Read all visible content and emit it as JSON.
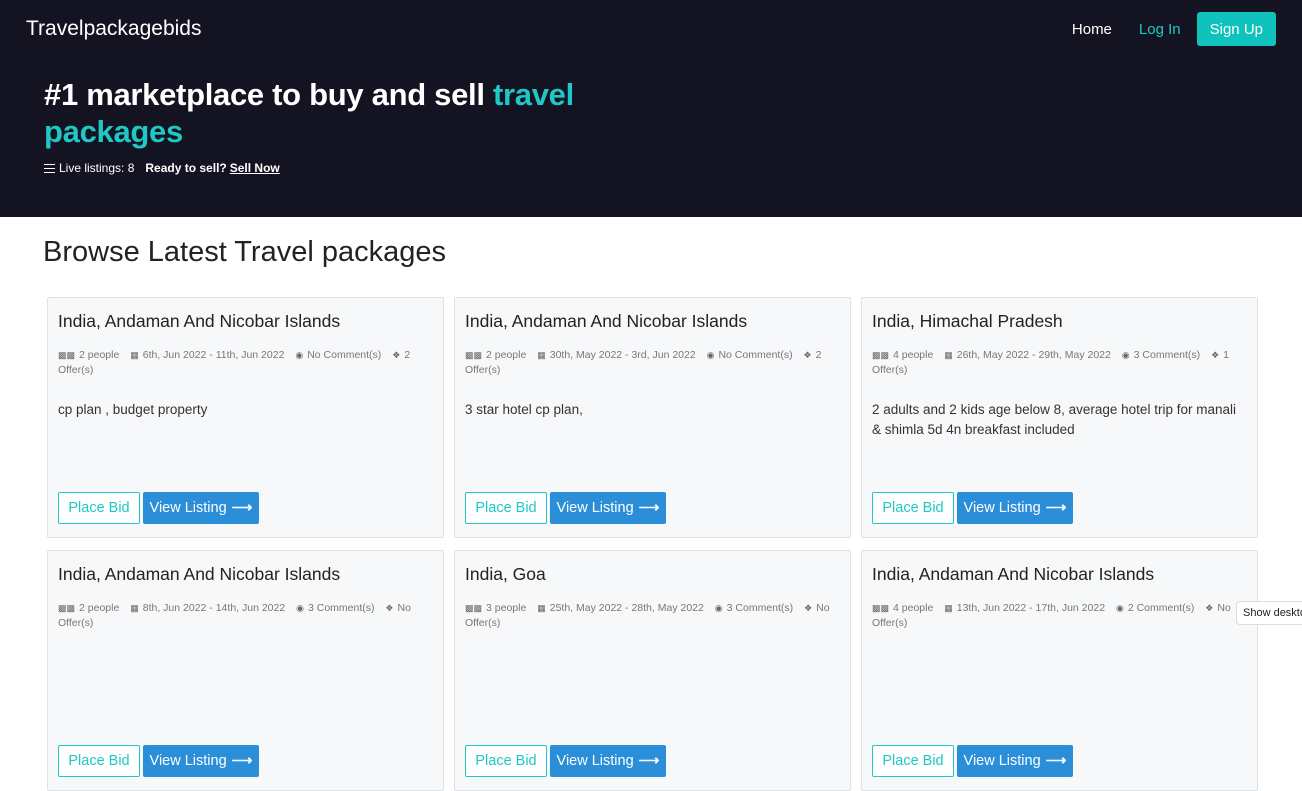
{
  "header": {
    "brand": "Travelpackagebids",
    "nav": {
      "home": "Home",
      "login": "Log In",
      "signup": "Sign Up"
    },
    "headline_main": "#1 marketplace to buy and sell ",
    "headline_accent": "travel packages",
    "live_listings": "Live listings: 8",
    "ready_text": "Ready to sell?",
    "sell_now": "Sell Now"
  },
  "section_title": "Browse Latest Travel packages",
  "listings": [
    {
      "title": "India, Andaman And Nicobar Islands",
      "people": "2 people",
      "dates": "6th, Jun 2022 - 11th, Jun 2022",
      "comments": "No Comment(s)",
      "offers_num": "2",
      "offers_label": "Offer(s)",
      "desc": "cp plan , budget property"
    },
    {
      "title": "India, Andaman And Nicobar Islands",
      "people": "2 people",
      "dates": "30th, May 2022 - 3rd, Jun 2022",
      "comments": "No Comment(s)",
      "offers_num": "2",
      "offers_label": "Offer(s)",
      "desc": "3 star hotel cp plan,"
    },
    {
      "title": "India, Himachal Pradesh",
      "people": "4 people",
      "dates": "26th, May 2022 - 29th, May 2022",
      "comments": "3 Comment(s)",
      "offers_num": "1",
      "offers_label": "Offer(s)",
      "desc": "2 adults and 2 kids age below 8, average hotel trip for manali & shimla 5d 4n breakfast included"
    },
    {
      "title": "India, Andaman And Nicobar Islands",
      "people": "2 people",
      "dates": "8th, Jun 2022 - 14th, Jun 2022",
      "comments": "3 Comment(s)",
      "offers_num": "No",
      "offers_label": "Offer(s)",
      "desc": ""
    },
    {
      "title": "India, Goa",
      "people": "3 people",
      "dates": "25th, May 2022 - 28th, May 2022",
      "comments": "3 Comment(s)",
      "offers_num": "No",
      "offers_label": "Offer(s)",
      "desc": ""
    },
    {
      "title": "India, Andaman And Nicobar Islands",
      "people": "4 people",
      "dates": "13th, Jun 2022 - 17th, Jun 2022",
      "comments": "2 Comment(s)",
      "offers_num": "No",
      "offers_label": "Offer(s)",
      "desc": ""
    }
  ],
  "buttons": {
    "place_bid": "Place Bid",
    "view_listing": "View Listing"
  },
  "toast": "Show desktop",
  "colors": {
    "hero_bg": "#141322",
    "accent": "#1fc8c4",
    "primary": "#2a8fd8"
  }
}
